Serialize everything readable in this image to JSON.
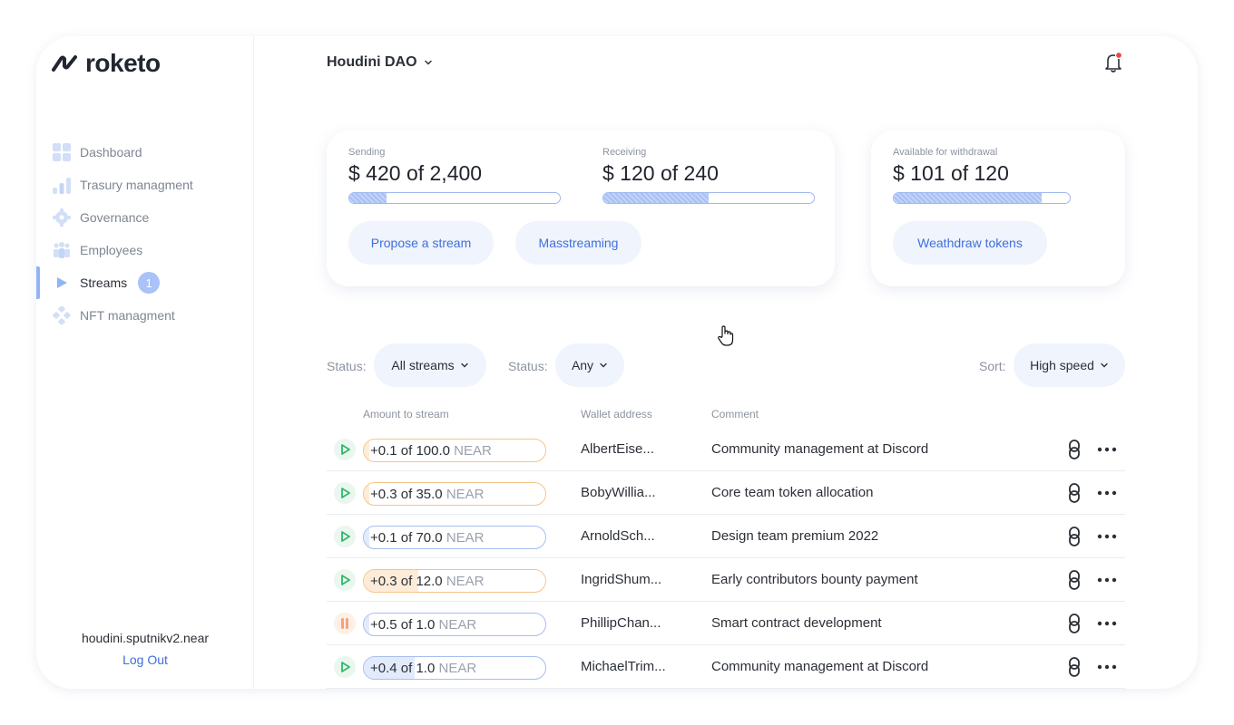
{
  "app": {
    "logo_text": "roketo"
  },
  "sidebar": {
    "items": [
      {
        "label": "Dashboard",
        "icon": "grid-icon"
      },
      {
        "label": "Trasury managment",
        "icon": "bar-chart-icon"
      },
      {
        "label": "Governance",
        "icon": "gear-icon"
      },
      {
        "label": "Employees",
        "icon": "people-icon"
      },
      {
        "label": "Streams",
        "icon": "play-icon",
        "badge": "1",
        "active": true
      },
      {
        "label": "NFT managment",
        "icon": "diamond-grid-icon"
      }
    ],
    "user": "houdini.sputnikv2.near",
    "logout": "Log Out"
  },
  "header": {
    "dao_name": "Houdini DAO"
  },
  "summary": {
    "sending": {
      "label": "Sending",
      "value": "$ 420  of 2,400",
      "progress": 0.175
    },
    "receiving": {
      "label": "Receiving",
      "value": "$ 120  of 240",
      "progress": 0.5
    },
    "available": {
      "label": "Available for withdrawal",
      "value": "$ 101 of 120",
      "progress": 0.84
    },
    "propose_label": "Propose a stream",
    "mass_label": "Masstreaming",
    "withdraw_label": "Weathdraw tokens"
  },
  "filters": {
    "status_label": "Status:",
    "status_value": "All streams",
    "status2_label": "Status:",
    "status2_value": "Any",
    "sort_label": "Sort:",
    "sort_value": "High speed"
  },
  "table": {
    "headers": {
      "amount": "Amount to stream",
      "wallet": "Wallet address",
      "comment": "Comment"
    },
    "rows": [
      {
        "status": "playing",
        "amount": "+0.1 of 100.0",
        "unit": "NEAR",
        "progress": 0.001,
        "direction": "outgoing",
        "wallet": "AlbertEise...",
        "comment": "Community management at Discord"
      },
      {
        "status": "playing",
        "amount": "+0.3 of 35.0",
        "unit": "NEAR",
        "progress": 0.01,
        "direction": "outgoing",
        "wallet": "BobyWillia...",
        "comment": "Core team token allocation"
      },
      {
        "status": "playing",
        "amount": "+0.1 of 70.0",
        "unit": "NEAR",
        "progress": 0.0015,
        "direction": "incoming",
        "wallet": "ArnoldSch...",
        "comment": "Design team premium 2022"
      },
      {
        "status": "playing",
        "amount": "+0.3 of 12.0",
        "unit": "NEAR",
        "progress": 0.3,
        "direction": "outgoing",
        "wallet": "IngridShum...",
        "comment": "Early contributors bounty payment"
      },
      {
        "status": "paused",
        "amount": "+0.5 of 1.0",
        "unit": "NEAR",
        "progress": 0.0,
        "direction": "incoming",
        "wallet": "PhillipChan...",
        "comment": "Smart contract development"
      },
      {
        "status": "playing",
        "amount": "+0.4 of 1.0",
        "unit": "NEAR",
        "progress": 0.28,
        "direction": "incoming",
        "wallet": "MichaelTrim...",
        "comment": "Community management at Discord"
      }
    ]
  },
  "colors": {
    "accent": "#3e6fdc",
    "play_green": "#2fb86a",
    "pause_orange": "#f5a27a",
    "outgoing_border": "#f6c489",
    "outgoing_fill": "#fdecd8",
    "incoming_border": "#a5bdf0",
    "incoming_fill": "#e2ebfc"
  }
}
